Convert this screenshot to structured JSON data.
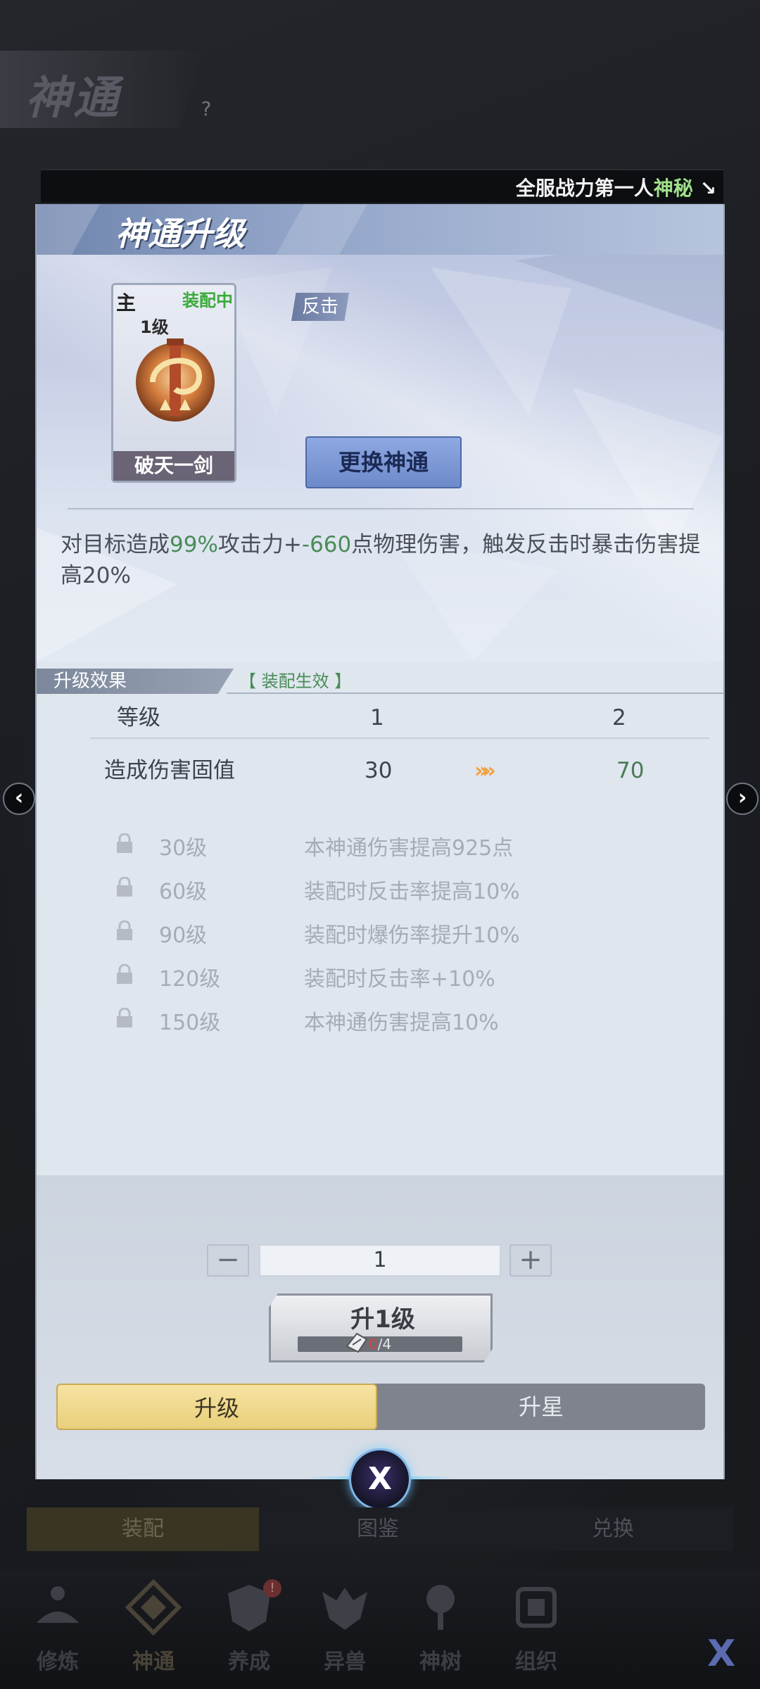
{
  "page": {
    "title": "神通",
    "help_label": "?"
  },
  "ticker": {
    "text_prefix": "全服战力第一人",
    "text_highlight": "神秘"
  },
  "panel": {
    "title": "神通升级",
    "card": {
      "main_badge": "主",
      "equipped_label": "装配中",
      "level": "1级",
      "name": "破天一剑"
    },
    "tag": "反击",
    "swap_button": "更换神通",
    "description_parts": [
      "对目标造成",
      "99%",
      "攻击力+",
      "-660",
      "点物理伤害，触发反击时暴击伤害提高20%"
    ]
  },
  "upgrade_effect": {
    "title": "升级效果",
    "note": "【 装配生效 】",
    "rows": [
      {
        "label": "等级",
        "current": "1",
        "next": "2"
      },
      {
        "label": "造成伤害固值",
        "current": "30",
        "next": "70"
      }
    ],
    "arrow": "»»"
  },
  "milestones": [
    {
      "level": "30级",
      "desc": "本神通伤害提高925点"
    },
    {
      "level": "60级",
      "desc": "装配时反击率提高10%"
    },
    {
      "level": "90级",
      "desc": "装配时爆伤率提升10%"
    },
    {
      "level": "120级",
      "desc": "装配时反击率+10%"
    },
    {
      "level": "150级",
      "desc": "本神通伤害提高10%"
    }
  ],
  "quantity": {
    "minus": "−",
    "value": "1",
    "plus": "+"
  },
  "upgrade_button": {
    "label": "升1级",
    "progress_have": "0",
    "progress_need": "/4"
  },
  "mode_tabs": {
    "upgrade": "升级",
    "star_up": "升星"
  },
  "close_label": "X",
  "side_arrows": {
    "left": "‹",
    "right": "›"
  },
  "sub_tabs": [
    "装配",
    "图鉴",
    "兑换"
  ],
  "bottom_nav": [
    {
      "label": "修炼"
    },
    {
      "label": "神通"
    },
    {
      "label": "养成"
    },
    {
      "label": "异兽"
    },
    {
      "label": "神树"
    },
    {
      "label": "组织"
    }
  ],
  "nav_badge": "!",
  "corner_label": "X",
  "colors": {
    "accent_green": "#4a8c57",
    "equipped_green": "#3aaa3a",
    "active_tab_gold": "#e9cf7a",
    "arrow_orange": "#f3a13e",
    "progress_red": "#d94343"
  }
}
